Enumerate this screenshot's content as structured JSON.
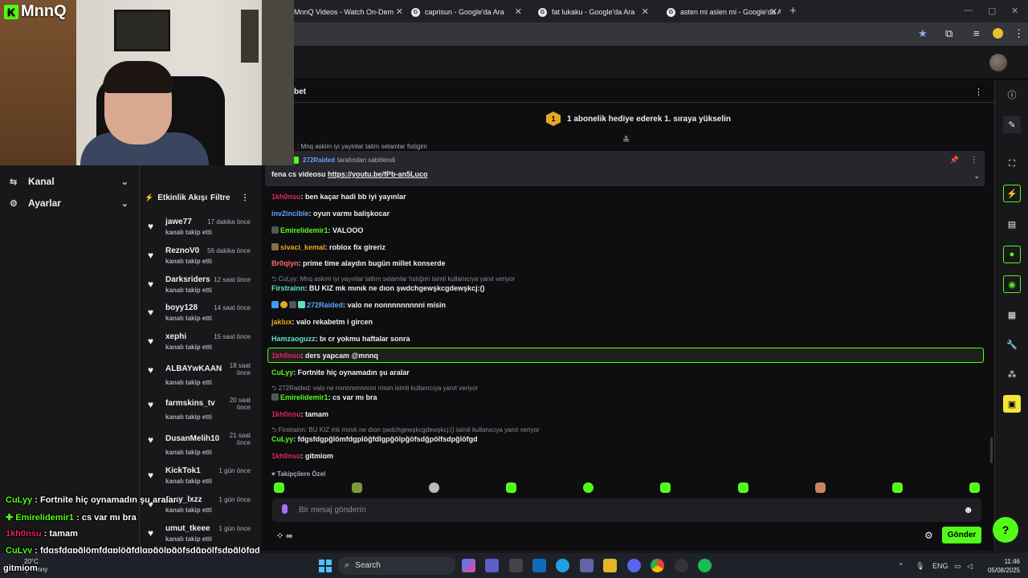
{
  "browser": {
    "tabs": [
      {
        "label": "MnnQ Videos - Watch On-Dem"
      },
      {
        "label": "caprisun - Google'da Ara"
      },
      {
        "label": "fat lukaku - Google'da Ara"
      },
      {
        "label": "asten mi aslen mi - Google'da A"
      }
    ],
    "new_tab": "+",
    "min": "—",
    "max": "▢",
    "close": "✕"
  },
  "stream": {
    "logo_text": "MnnQ",
    "logo_mark": "K"
  },
  "sidebar": {
    "items": [
      {
        "label": "Kanal",
        "icon": "channel-icon"
      },
      {
        "label": "Ayarlar",
        "icon": "gear-icon"
      }
    ]
  },
  "activity": {
    "title": "Etkinlik Akışı",
    "filter": "Filtre",
    "items": [
      {
        "name": "jawe77",
        "time": "17 dakika önce",
        "action": "kanalı takip etti"
      },
      {
        "name": "ReznoV0",
        "time": "56 dakika önce",
        "action": "kanalı takip etti"
      },
      {
        "name": "Darksriders",
        "time": "12 saat önce",
        "action": "kanalı takip etti"
      },
      {
        "name": "boyy128",
        "time": "14 saat önce",
        "action": "kanalı takip etti"
      },
      {
        "name": "xephi",
        "time": "15 saat önce",
        "action": "kanalı takip etti"
      },
      {
        "name": "ALBAYwKAAN",
        "time": "18 saat önce",
        "action": "kanalı takip etti"
      },
      {
        "name": "farmskins_tv",
        "time": "20 saat önce",
        "action": "kanalı takip etti"
      },
      {
        "name": "DusanMelih10",
        "time": "21 saat önce",
        "action": "kanalı takip etti"
      },
      {
        "name": "KickTok1",
        "time": "1 gün önce",
        "action": "kanalı takip etti"
      },
      {
        "name": "Jzay_lxzz",
        "time": "1 gün önce",
        "action": "kanalı takip etti"
      },
      {
        "name": "umut_tkeee",
        "time": "1 gün önce",
        "action": "kanalı takip etti"
      }
    ]
  },
  "chat": {
    "title": "bet",
    "sub_goal": "1 abonelik hediye ederek 1. sıraya yükselin",
    "sub_goal_badge": "1",
    "cut_line": ": Mnq askim iyi yayinlar tatim selamlar fistigim",
    "pinned": {
      "by_user": "272Raided",
      "by_text": "tarafından sabitlendi",
      "text": "fena cs videosu ",
      "link": "https://youtu.be/fPb-an5Luco"
    },
    "messages": [
      {
        "user": "1kh0nsu",
        "color": "#e0245e",
        "text": ": ben kaçar hadi bb iyi yayınlar"
      },
      {
        "user": "inv2incible",
        "color": "#5fa3ff",
        "text": ": oyun varmı balişkocar"
      },
      {
        "user": "Emirelidemir1",
        "color": "#53fc18",
        "text": ": VALOOO"
      },
      {
        "user": "sivaci_kemal",
        "color": "#e5a823",
        "text": ": roblox fix gireriz"
      },
      {
        "user": "Br0qiyn",
        "color": "#ff6b6b",
        "text": ": prime time alaydın bugün millet konserde"
      },
      {
        "user": "Firstrainn",
        "color": "#5fe0c0",
        "text": ": BU KIZ mk mınık ne dıon şwdchgewşkcgdewşkcj:()"
      },
      {
        "user": "272Raided",
        "color": "#5fa3ff",
        "text": ": valo ne nonnnnnnnnni misin"
      },
      {
        "user": "jaklux",
        "color": "#e5a823",
        "text": ": valo rekabetm i gircen"
      },
      {
        "user": "Hamzaoguzz",
        "color": "#5fe0c0",
        "text": ": bı cr yokmu haftalar sonra"
      },
      {
        "user": "1kh0nsu",
        "color": "#e0245e",
        "text": ": ders yapcam @mnnq"
      },
      {
        "user": "CuLyy",
        "color": "#53fc18",
        "text": ": Fortnite hiç oynamadın şu aralar"
      },
      {
        "user": "Emirelidemir1",
        "color": "#53fc18",
        "text": ": cs var mı bra"
      },
      {
        "user": "1kh0nsu",
        "color": "#e0245e",
        "text": ": tamam"
      },
      {
        "user": "CuLyy",
        "color": "#53fc18",
        "text": ": fdgsfdgpğlömfdgplöğfdlgpğölpğöfsdğpölfsdpğlöfgd"
      },
      {
        "user": "1kh0nsu",
        "color": "#e0245e",
        "text": ": gitmiom"
      }
    ],
    "replies": [
      {
        "text": "CuLyy: Mnq askım iyi yayınlar tatlım selamlar fıstığım isimli kullanıcıya yanıt veriyor"
      },
      {
        "text": "272Raided: valo ne nonnnnnnnnni misin isimli kullanıcıya yanıt veriyor"
      },
      {
        "text": "Firstrainn: BU KIZ mk mınık ne dıon şwdchgewşkcgdewşkcj:() isimli kullanıcıya yanıt veriyor"
      }
    ],
    "emotes_header": "Takipçilere Özel",
    "input_placeholder": "Bir mesaj gönderin",
    "points": "∞",
    "send": "Gönder"
  },
  "overlay": [
    {
      "user": "CuLyy",
      "color": "#53fc18",
      "text": " : Fortnite hiç oynamadın şu aralar"
    },
    {
      "user": "Emirelidemir1",
      "color": "#53fc18",
      "text": " : cs var mı bra"
    },
    {
      "user": "1kh0nsu",
      "color": "#e0245e",
      "text": " : tamam"
    },
    {
      "user": "CuLyy",
      "color": "#53fc18",
      "text": " : fdgsfdgpğlömfdgplöğfdlgpğölpğöfsdğpölfsdpğlöfgd"
    },
    {
      "user": "gitmiom",
      "color": "#ffffff",
      "text": ""
    }
  ],
  "weather": {
    "temp": "20°C",
    "cond": "ly sunny"
  },
  "taskbar": {
    "search": "Search",
    "lang": "ENG",
    "time": "11:46",
    "date": "05/08/2025"
  },
  "colors": {
    "accent": "#53fc18",
    "bg": "#0e0e10",
    "panel": "#18181b"
  }
}
